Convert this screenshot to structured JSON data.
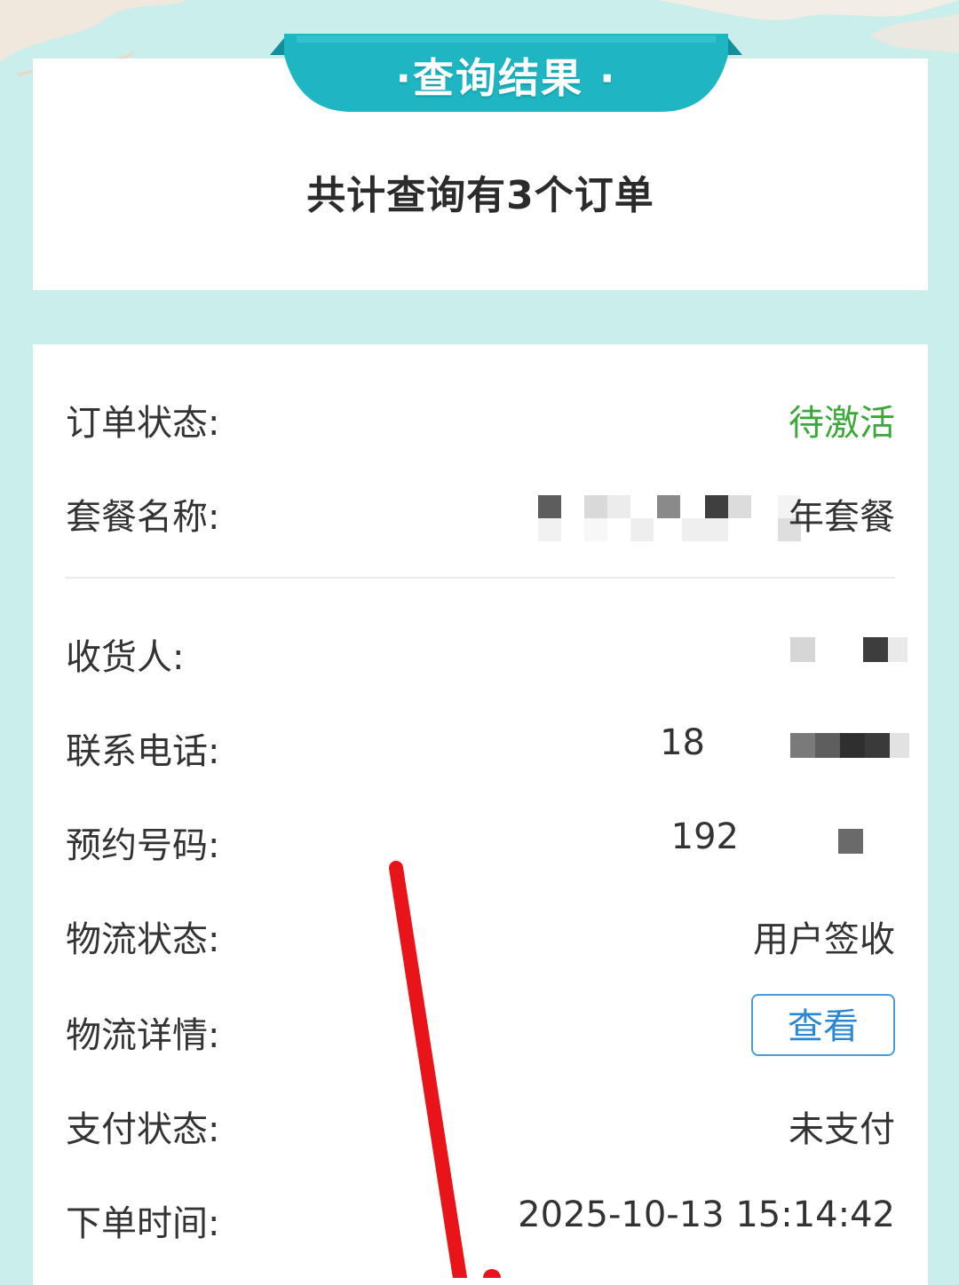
{
  "banner": {
    "title": "·查询结果 ·"
  },
  "summary": {
    "text": "共计查询有3个订单"
  },
  "order": {
    "status": {
      "label": "订单状态:",
      "value": "待激活"
    },
    "package": {
      "label": "套餐名称:",
      "value_visible": "年套餐"
    },
    "receiver": {
      "label": "收货人:"
    },
    "phone": {
      "label": "联系电话:",
      "value_visible": "18"
    },
    "reservation": {
      "label": "预约号码:",
      "value_visible": "192"
    },
    "logistics_status": {
      "label": "物流状态:",
      "value": "用户签收"
    },
    "logistics_detail": {
      "label": "物流详情:",
      "button_label": "查看"
    },
    "payment_status": {
      "label": "支付状态:",
      "value": "未支付"
    },
    "order_time": {
      "label": "下单时间:",
      "value": "2025-10-13 15:14:42"
    }
  },
  "colors": {
    "background": "#c9eeec",
    "banner": "#1fb6c4",
    "status_green": "#3aa83a",
    "button_blue": "#2a86d0",
    "annotation_red": "#e8141a"
  }
}
